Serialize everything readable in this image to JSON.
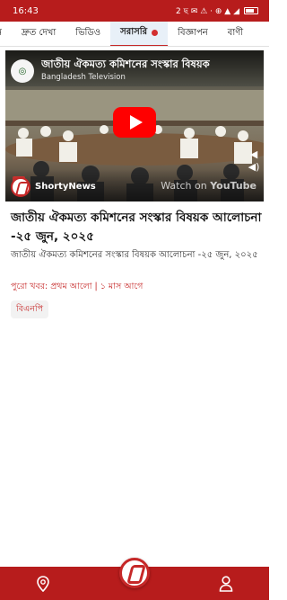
{
  "status_bar": {
    "time": "16:43",
    "right_text": "2 ছ ✉ ⚠ · ⊕ ▲ ◢"
  },
  "tabs": [
    {
      "label": "ন"
    },
    {
      "label": "দ্রুত দেখা"
    },
    {
      "label": "ভিডিও"
    },
    {
      "label": "সরাসরি",
      "active": true
    },
    {
      "label": "বিজ্ঞাপন"
    },
    {
      "label": "বাণী"
    }
  ],
  "video": {
    "title": "জাতীয় ঐকমত্য কমিশনের সংস্কার বিষয়ক",
    "channel": "Bangladesh Television",
    "brand": "ShortyNews",
    "watch_on": "Watch on",
    "watch_brand": "YouTube"
  },
  "article": {
    "headline": "জাতীয় ঐকমত্য কমিশনের সংস্কার বিষয়ক আলোচনা -২৫ জুন, ২০২৫",
    "summary": "জাতীয় ঐকমত্য কমিশনের সংস্কার বিষয়ক আলোচনা -২৫ জুন, ২০২৫",
    "source_label": "পুরো খবর:",
    "source_value": "প্রথম আলো | ১ মাস আগে",
    "tag": "বিএনপি"
  },
  "bottom_nav": {
    "items": [
      {
        "icon": "location-pin-icon"
      },
      {
        "icon": "shorty-logo-icon"
      },
      {
        "icon": "user-icon"
      }
    ]
  },
  "colors": {
    "brand_red": "#b71c1c",
    "accent_red": "#c62828",
    "youtube_red": "#ff0000"
  }
}
